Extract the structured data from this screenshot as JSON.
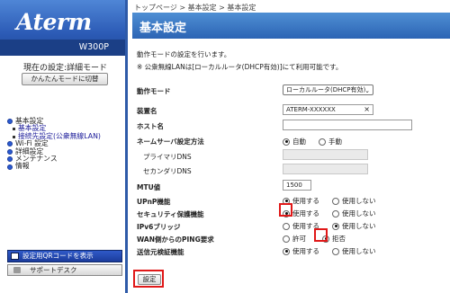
{
  "sidebar": {
    "logo": "Aterm",
    "model": "W300P",
    "current_mode": "現在の設定:詳細モード",
    "switch_mode_button": "かんたんモードに切替",
    "nav": [
      {
        "label": "基本設定",
        "type": "main"
      },
      {
        "label": "基本設定",
        "type": "sub"
      },
      {
        "label": "接続先設定(公衆無線LAN)",
        "type": "sub"
      },
      {
        "label": "Wi-Fi 設定",
        "type": "main"
      },
      {
        "label": "詳細設定",
        "type": "main"
      },
      {
        "label": "メンテナンス",
        "type": "main"
      },
      {
        "label": "情報",
        "type": "main"
      }
    ],
    "qr_button": "設定用QRコードを表示",
    "support_button": "サポートデスク"
  },
  "breadcrumb": "トップページ > 基本設定 > 基本設定",
  "page_title": "基本設定",
  "description": "動作モードの設定を行います。",
  "note": "※ 公衆無線LANは[ローカルルータ(DHCP有効)]にて利用可能です。",
  "form": {
    "operation_mode": {
      "label": "動作モード",
      "value": "ローカルルータ(DHCP有効)"
    },
    "device_name": {
      "label": "装置名",
      "value": "ATERM-XXXXXX",
      "clear_glyph": "×"
    },
    "host_name": {
      "label": "ホスト名",
      "value": ""
    },
    "nameserver": {
      "label": "ネームサーバ設定方法",
      "options": [
        "自動",
        "手動"
      ],
      "selected": 0
    },
    "primary_dns": {
      "label": "プライマリDNS",
      "value": ""
    },
    "secondary_dns": {
      "label": "セカンダリDNS",
      "value": ""
    },
    "mtu": {
      "label": "MTU値",
      "value": "1500"
    },
    "upnp": {
      "label": "UPnP機能",
      "options": [
        "使用する",
        "使用しない"
      ],
      "selected": 0
    },
    "security": {
      "label": "セキュリティ保護機能",
      "options": [
        "使用する",
        "使用しない"
      ],
      "selected": 0
    },
    "ipv6": {
      "label": "IPv6ブリッジ",
      "options": [
        "使用する",
        "使用しない"
      ],
      "selected": 1
    },
    "wan_ping": {
      "label": "WAN側からのPING要求",
      "options": [
        "許可",
        "拒否"
      ],
      "selected": 1
    },
    "source_verify": {
      "label": "送信元検証機能",
      "options": [
        "使用する",
        "使用しない"
      ],
      "selected": 0
    }
  },
  "submit_button": "設定",
  "colors": {
    "accent": "#2c64b4",
    "highlight": "#e01818",
    "sidebar_divider": "#2e5aa8"
  }
}
